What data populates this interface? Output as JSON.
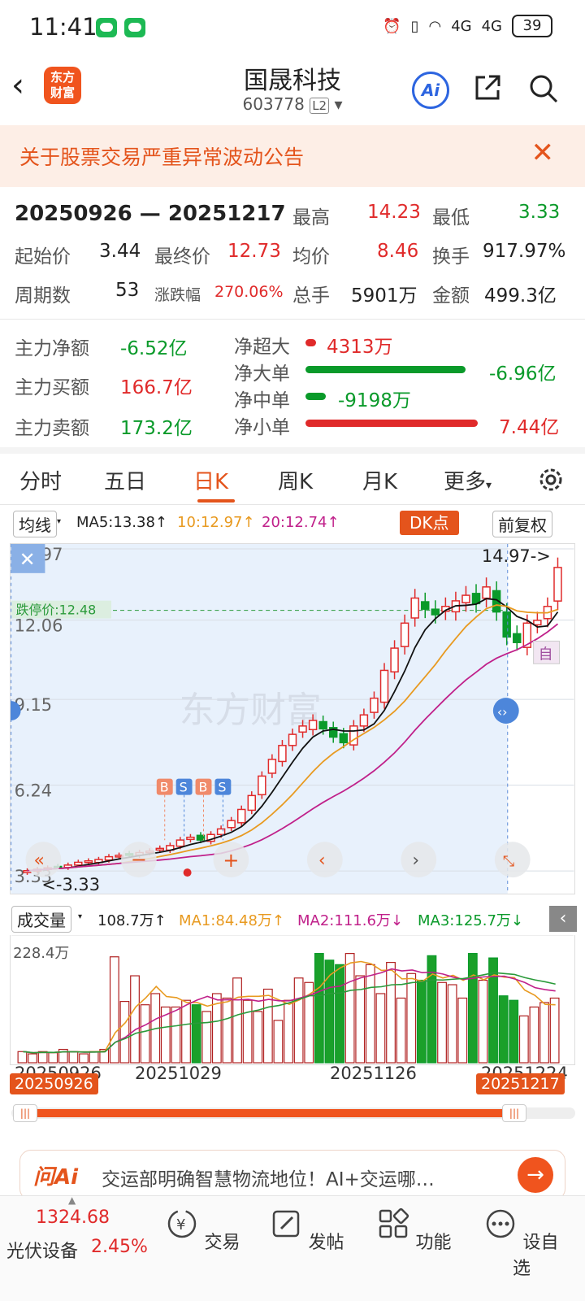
{
  "status_bar": {
    "time": "11:41",
    "signal1": "4G",
    "signal2": "4G",
    "battery": "39"
  },
  "header": {
    "title": "国晟科技",
    "code": "603778",
    "level": "L2",
    "logo_line1": "东方",
    "logo_line2": "财富",
    "ai_label": "Ai"
  },
  "notice": {
    "text": "关于股票交易严重异常波动公告"
  },
  "stats": {
    "range": "20250926 — 20251217",
    "high_label": "最高",
    "high": "14.23",
    "low_label": "最低",
    "low": "3.33",
    "start_label": "起始价",
    "start": "3.44",
    "end_label": "最终价",
    "end": "12.73",
    "avg_label": "均价",
    "avg": "8.46",
    "turnover_label": "换手",
    "turnover": "917.97%",
    "periods_label": "周期数",
    "periods": "53",
    "change_label": "涨跌幅",
    "change": "270.06%",
    "vol_label": "总手",
    "vol": "5901万",
    "amount_label": "金额",
    "amount": "499.3亿"
  },
  "funds": {
    "net_label": "主力净额",
    "net": "-6.52亿",
    "buy_label": "主力买额",
    "buy": "166.7亿",
    "sell_label": "主力卖额",
    "sell": "173.2亿",
    "rows": [
      {
        "label": "净超大",
        "value": "4313万",
        "color": "#e02a2a",
        "fraction": 0.06
      },
      {
        "label": "净大单",
        "value": "-6.96亿",
        "color": "#0a9a2a",
        "fraction": 0.93
      },
      {
        "label": "净中单",
        "value": "-9198万",
        "color": "#0a9a2a",
        "fraction": 0.12
      },
      {
        "label": "净小单",
        "value": "7.44亿",
        "color": "#e02a2a",
        "fraction": 1.0
      }
    ]
  },
  "tabs": [
    "分时",
    "五日",
    "日K",
    "周K",
    "月K",
    "更多"
  ],
  "active_tab": "日K",
  "ma": {
    "mode": "均线",
    "ma5": "MA5:13.38↑",
    "ma10": "10:12.97↑",
    "ma20": "20:12.74↑",
    "dk": "DK点",
    "adjust": "前复权"
  },
  "kline": {
    "y_labels": [
      "14.97",
      "12.06",
      "9.15",
      "6.24",
      "3.33"
    ],
    "limit_down": "跌停价:12.48",
    "max_marker": "14.97->",
    "min_marker": "<-3.33",
    "auto_label": "自",
    "watermark": "东方财富"
  },
  "volume": {
    "label": "成交量",
    "value": "108.7万↑",
    "ma1": "MA1:84.48万↑",
    "ma2": "MA2:111.6万↓",
    "ma3": "MA3:125.7万↓",
    "y_label": "228.4万"
  },
  "dates": {
    "d1": "20250926",
    "d2": "20251029",
    "d3": "20251126",
    "d4": "20251224"
  },
  "range": {
    "start": "20250926",
    "end": "20251217"
  },
  "ask_ai": {
    "logo": "问Ai",
    "text": "交运部明确智慧物流地位！AI+交运哪…"
  },
  "bottom": {
    "index_value": "1324.68",
    "index_name": "光伏设备",
    "index_change": "2.45%",
    "items": [
      "交易",
      "发帖",
      "功能",
      "设自选"
    ]
  },
  "colors": {
    "accent": "#e4541c",
    "up": "#e02a2a",
    "down": "#0a9a2a"
  }
}
